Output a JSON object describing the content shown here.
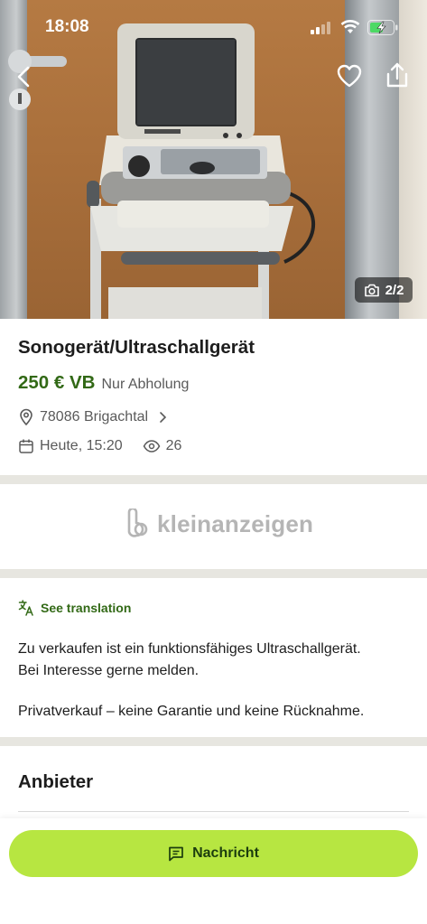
{
  "status_bar": {
    "time": "18:08"
  },
  "gallery": {
    "counter": "2/2"
  },
  "listing": {
    "title": "Sonogerät/Ultraschallgerät",
    "price": "250 € VB",
    "pickup": "Nur Abholung",
    "location": "78086 Brigachtal",
    "date": "Heute, 15:20",
    "views": "26"
  },
  "brand": {
    "name": "kleinanzeigen"
  },
  "description": {
    "translate_label": "See translation",
    "line1": "Zu verkaufen ist ein funktionsfähiges Ultraschallgerät.",
    "line2": "Bei Interesse gerne melden.",
    "line3": "Privatverkauf – keine Garantie und keine Rücknahme."
  },
  "seller": {
    "section_title": "Anbieter"
  },
  "actions": {
    "message_label": "Nachricht"
  },
  "colors": {
    "price": "#326916",
    "cta": "#b7e641",
    "divider": "#e7e6e0"
  },
  "icons": [
    "back-icon",
    "heart-icon",
    "share-icon",
    "camera-icon",
    "location-pin-icon",
    "chevron-right-icon",
    "calendar-icon",
    "eye-icon",
    "translate-icon",
    "message-icon"
  ]
}
